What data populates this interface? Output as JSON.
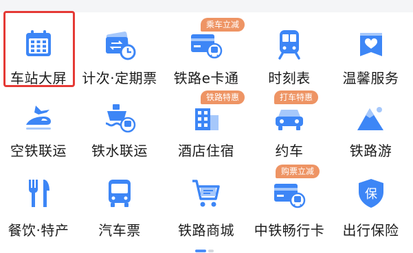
{
  "menu": {
    "items": [
      {
        "label": "车站大屏",
        "icon": "calendar-icon"
      },
      {
        "label": "计次·定期票",
        "icon": "ticket-clock-icon"
      },
      {
        "label": "铁路e卡通",
        "icon": "train-card-icon",
        "badge": "乘车立减"
      },
      {
        "label": "时刻表",
        "icon": "train-front-icon"
      },
      {
        "label": "温馨服务",
        "icon": "heart-bag-icon"
      },
      {
        "label": "空铁联运",
        "icon": "plane-train-icon"
      },
      {
        "label": "铁水联运",
        "icon": "ship-train-icon"
      },
      {
        "label": "酒店住宿",
        "icon": "hotel-icon",
        "badge": "铁路特惠"
      },
      {
        "label": "约车",
        "icon": "car-icon",
        "badge": "打车特惠"
      },
      {
        "label": "铁路游",
        "icon": "mountain-icon"
      },
      {
        "label": "餐饮·特产",
        "icon": "fork-knife-icon"
      },
      {
        "label": "汽车票",
        "icon": "bus-icon"
      },
      {
        "label": "铁路商城",
        "icon": "shopping-cart-icon"
      },
      {
        "label": "中铁畅行卡",
        "icon": "card-train-icon",
        "badge": "购票立减"
      },
      {
        "label": "出行保险",
        "icon": "shield-bao-icon"
      }
    ],
    "selected_index": 0
  },
  "colors": {
    "icon_blue": "#3d86f6",
    "icon_light": "#a6c8fb",
    "badge": "#ee9464",
    "highlight": "#e53935"
  },
  "pager": {
    "pages": 2,
    "current": 1
  }
}
